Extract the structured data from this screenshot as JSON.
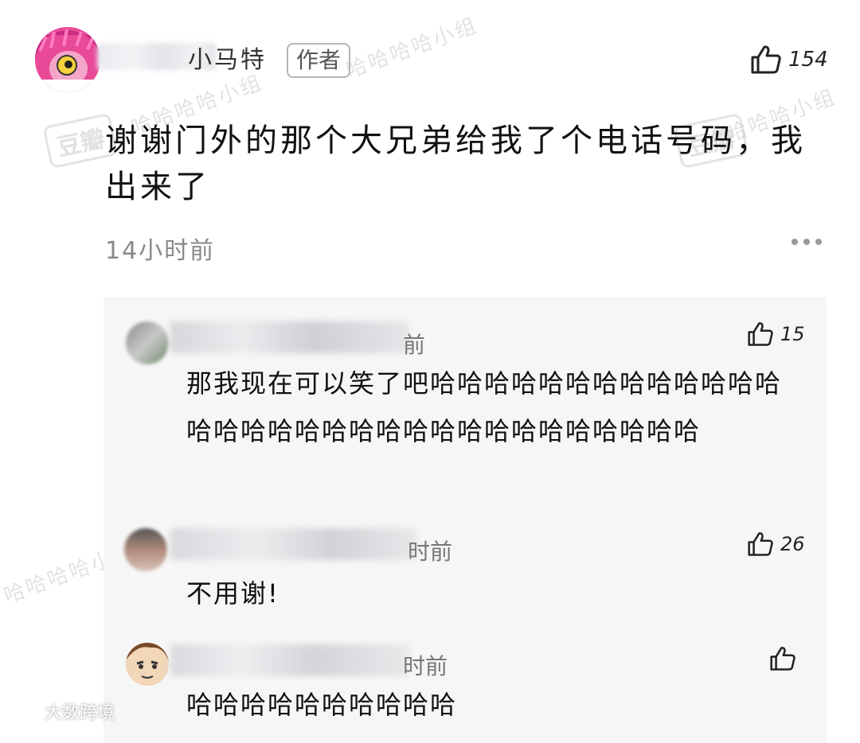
{
  "main_comment": {
    "username": "小马特",
    "author_badge": "作者",
    "likes": "154",
    "text": "谢谢门外的那个大兄弟给我了个电话号码，我出来了",
    "time": "14小时前"
  },
  "replies": [
    {
      "time": "前",
      "likes": "15",
      "text": "那我现在可以笑了吧哈哈哈哈哈哈哈哈哈哈哈哈哈哈哈哈哈哈哈哈哈哈哈哈哈哈哈哈哈哈哈哈"
    },
    {
      "time": "时前",
      "likes": "26",
      "text": "不用谢!"
    },
    {
      "time": "时前",
      "likes": "",
      "text": "哈哈哈哈哈哈哈哈哈哈"
    }
  ],
  "watermark": {
    "group": "哈哈哈哈小组",
    "brand": "豆瓣"
  },
  "bottom_brand": "大数跨境",
  "icons": {
    "like": "thumbs-up-icon",
    "more": "more-dots-icon"
  },
  "colors": {
    "avatar_pink": "#e84a98",
    "panel_bg": "#f6f6f6",
    "muted_text": "#888888"
  }
}
